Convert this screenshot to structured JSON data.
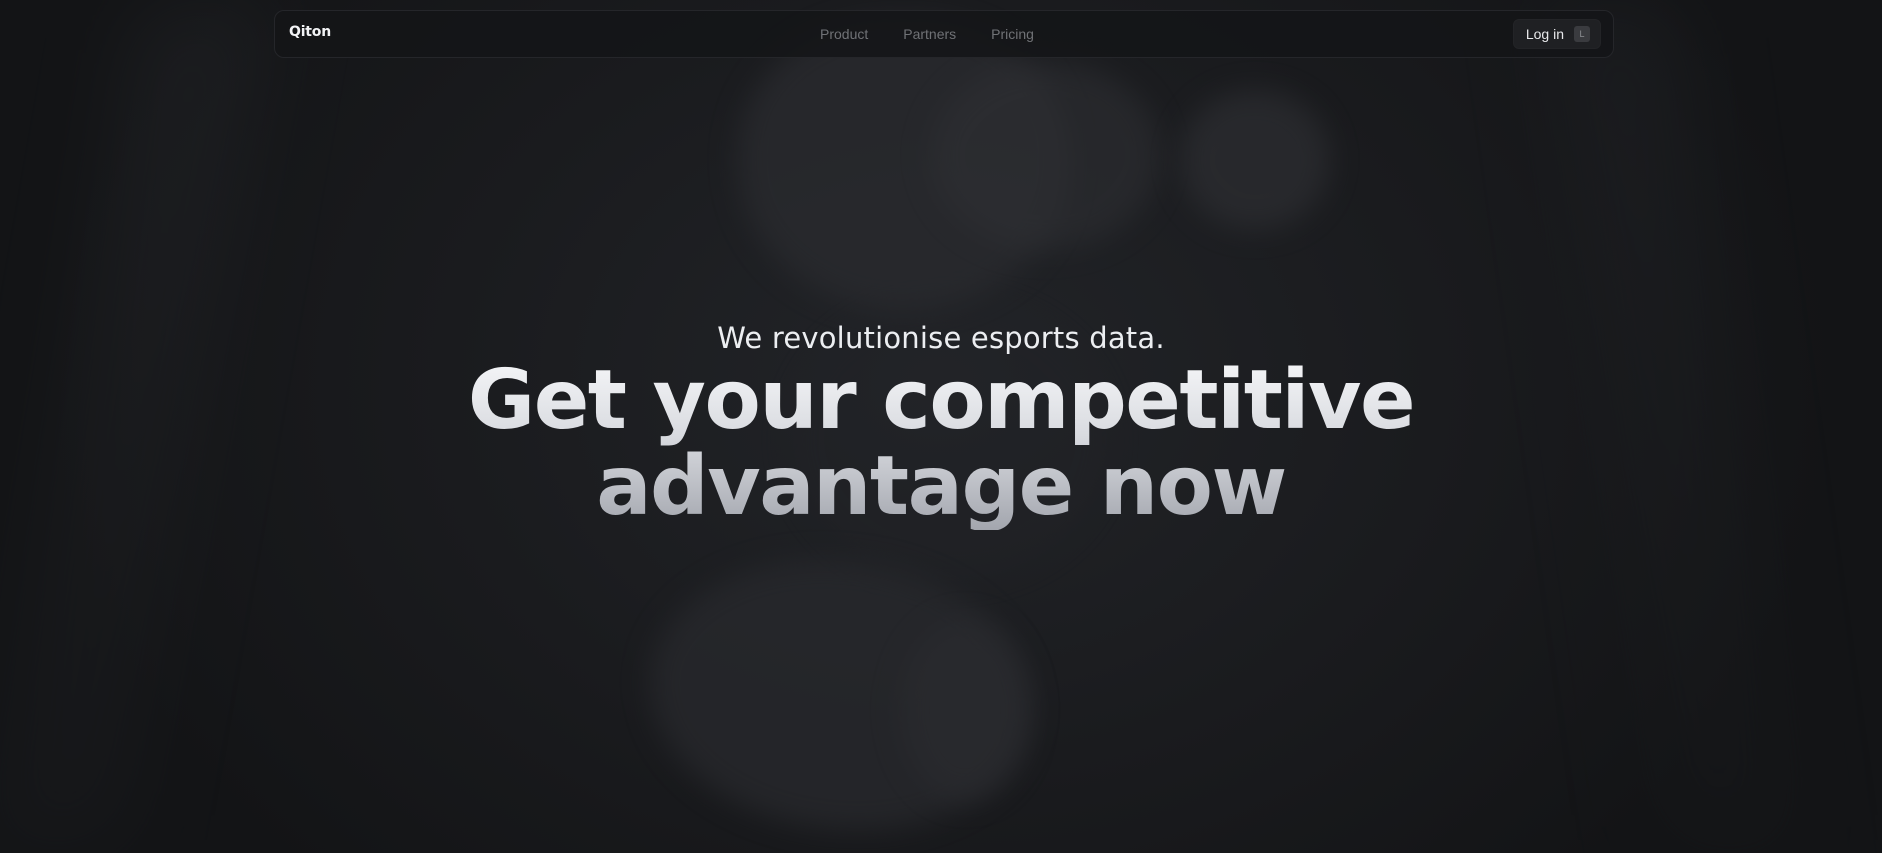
{
  "brand": {
    "logo_text": "Qiton"
  },
  "nav": {
    "items": [
      {
        "label": "Product"
      },
      {
        "label": "Partners"
      },
      {
        "label": "Pricing"
      }
    ],
    "login": {
      "label": "Log in",
      "shortcut": "L"
    }
  },
  "hero": {
    "tagline": "We revolutionise esports data.",
    "headline_line1": "Get your competitive",
    "headline_line2": "advantage now"
  },
  "colors": {
    "background": "#161719",
    "nav_link": "#707276",
    "headline_top": "#f5f6f8",
    "headline_bottom": "#a3a6ae"
  }
}
